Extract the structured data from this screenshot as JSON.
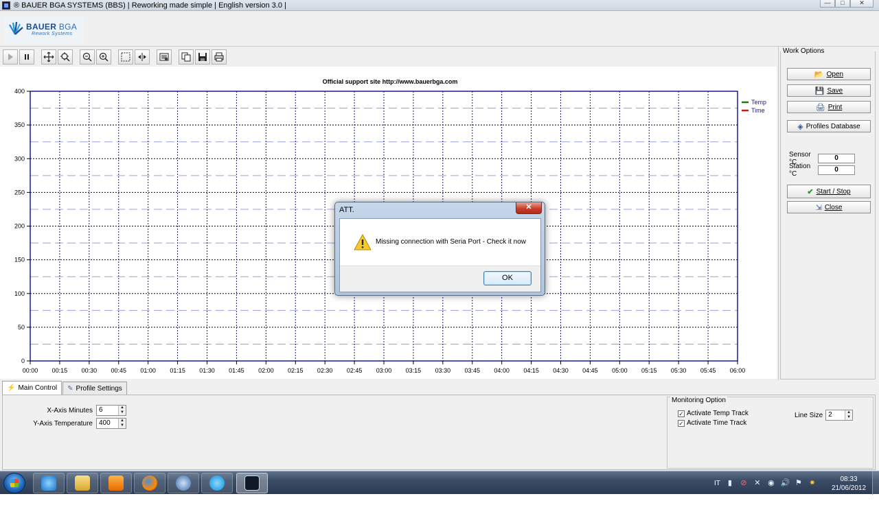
{
  "window": {
    "title": "® BAUER BGA SYSTEMS (BBS) | Reworking made simple | English version 3.0 |",
    "minimize": "—",
    "maximize": "□",
    "close": "✕"
  },
  "logo": {
    "brand": "BAUER",
    "brand_bga": "BGA",
    "subtitle": "Rework Systems"
  },
  "toolbar": {
    "buttons": [
      {
        "name": "play",
        "glyph": "▶"
      },
      {
        "name": "pause",
        "glyph": "❚❚"
      },
      {
        "name": "pan",
        "glyph": "✥"
      },
      {
        "name": "zoom-area",
        "glyph": "⊕"
      },
      {
        "name": "zoom-out",
        "glyph": "⊖"
      },
      {
        "name": "zoom-in",
        "glyph": "⊕"
      },
      {
        "name": "select",
        "glyph": "⬚"
      },
      {
        "name": "fit",
        "glyph": "⇹"
      },
      {
        "name": "properties",
        "glyph": "▤"
      },
      {
        "name": "copy",
        "glyph": "⧉"
      },
      {
        "name": "save",
        "glyph": "▣"
      },
      {
        "name": "print",
        "glyph": "⎙"
      }
    ]
  },
  "chart_data": {
    "type": "line",
    "title": "Official support site http://www.bauerbga.com",
    "xlabel": "",
    "ylabel": "",
    "ylim": [
      0,
      400
    ],
    "yticks": [
      "0",
      "50",
      "100",
      "150",
      "200",
      "250",
      "300",
      "350",
      "400"
    ],
    "xticks": [
      "00:00",
      "00:15",
      "00:30",
      "00:45",
      "01:00",
      "01:15",
      "01:30",
      "01:45",
      "02:00",
      "02:15",
      "02:30",
      "02:45",
      "03:00",
      "03:15",
      "03:30",
      "03:45",
      "04:00",
      "04:15",
      "04:30",
      "04:45",
      "05:00",
      "05:15",
      "05:30",
      "05:45",
      "06:00"
    ],
    "grid": true,
    "legend_position": "top-right",
    "series": [
      {
        "name": "Temp",
        "color": "#1a7a1a",
        "values": []
      },
      {
        "name": "Time",
        "color": "#cc1a1a",
        "values": []
      }
    ]
  },
  "work_options": {
    "title": "Work Options",
    "open": "Open",
    "save": "Save",
    "print": "Print",
    "profiles_db": "Profiles Database",
    "sensor_label": "Sensor °C",
    "sensor_value": "0",
    "station_label": "Station °C",
    "station_value": "0",
    "start_stop": "Start / Stop",
    "close": "Close"
  },
  "dialog": {
    "title": "ATT.",
    "message": "Missing connection with Seria Port - Check it now",
    "ok": "OK",
    "close": "✕"
  },
  "tabs": [
    {
      "label": "Main Control",
      "active": true
    },
    {
      "label": "Profile Settings",
      "active": false
    }
  ],
  "main_control": {
    "x_axis_label": "X-Axis Minutes",
    "x_axis_value": "6",
    "y_axis_label": "Y-Axis Temperature",
    "y_axis_value": "400"
  },
  "monitoring": {
    "title": "Monitoring Option",
    "temp_track": "Activate Temp Track",
    "time_track": "Activate Time  Track",
    "line_size_label": "Line Size",
    "line_size_value": "2"
  },
  "taskbar": {
    "apps": [
      "internet-explorer",
      "file-explorer",
      "media-player",
      "firefox",
      "thunderbird",
      "skype",
      "bauer-bga"
    ],
    "language": "IT",
    "time": "08:33",
    "date": "21/06/2012"
  }
}
